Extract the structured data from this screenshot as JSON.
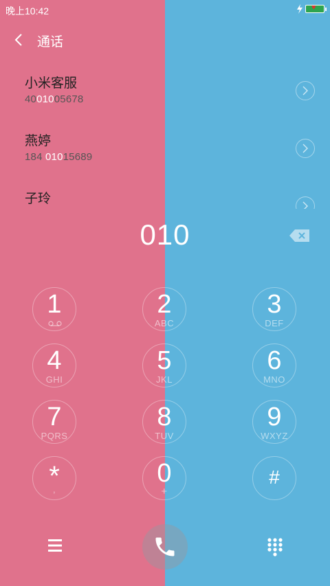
{
  "status": {
    "time": "晚上10:42"
  },
  "header": {
    "title": "通话"
  },
  "contacts": [
    {
      "name": "小米客服",
      "number_pre": "40",
      "number_hl": "010",
      "number_post": "05678"
    },
    {
      "name": "燕婷",
      "number_pre": "184 ",
      "number_hl": "010",
      "number_post": "15689"
    },
    {
      "name": "子玲",
      "number_pre": "",
      "number_hl": "",
      "number_post": ""
    }
  ],
  "dialer": {
    "dialed_number": "010"
  },
  "keys": [
    {
      "digit": "1",
      "letters": ""
    },
    {
      "digit": "2",
      "letters": "ABC"
    },
    {
      "digit": "3",
      "letters": "DEF"
    },
    {
      "digit": "4",
      "letters": "GHI"
    },
    {
      "digit": "5",
      "letters": "JKL"
    },
    {
      "digit": "6",
      "letters": "MNO"
    },
    {
      "digit": "7",
      "letters": "PQRS"
    },
    {
      "digit": "8",
      "letters": "TUV"
    },
    {
      "digit": "9",
      "letters": "WXYZ"
    },
    {
      "digit": "*",
      "letters": ","
    },
    {
      "digit": "0",
      "letters": "+"
    },
    {
      "digit": "#",
      "letters": ""
    }
  ],
  "colors": {
    "left_bg": "#e0728c",
    "right_bg": "#5db4dc"
  },
  "icons": [
    "back-icon",
    "charge-icon",
    "battery-icon",
    "contact-arrow-icon",
    "backspace-icon",
    "voicemail-icon",
    "menu-icon",
    "phone-icon",
    "dialpad-icon"
  ]
}
